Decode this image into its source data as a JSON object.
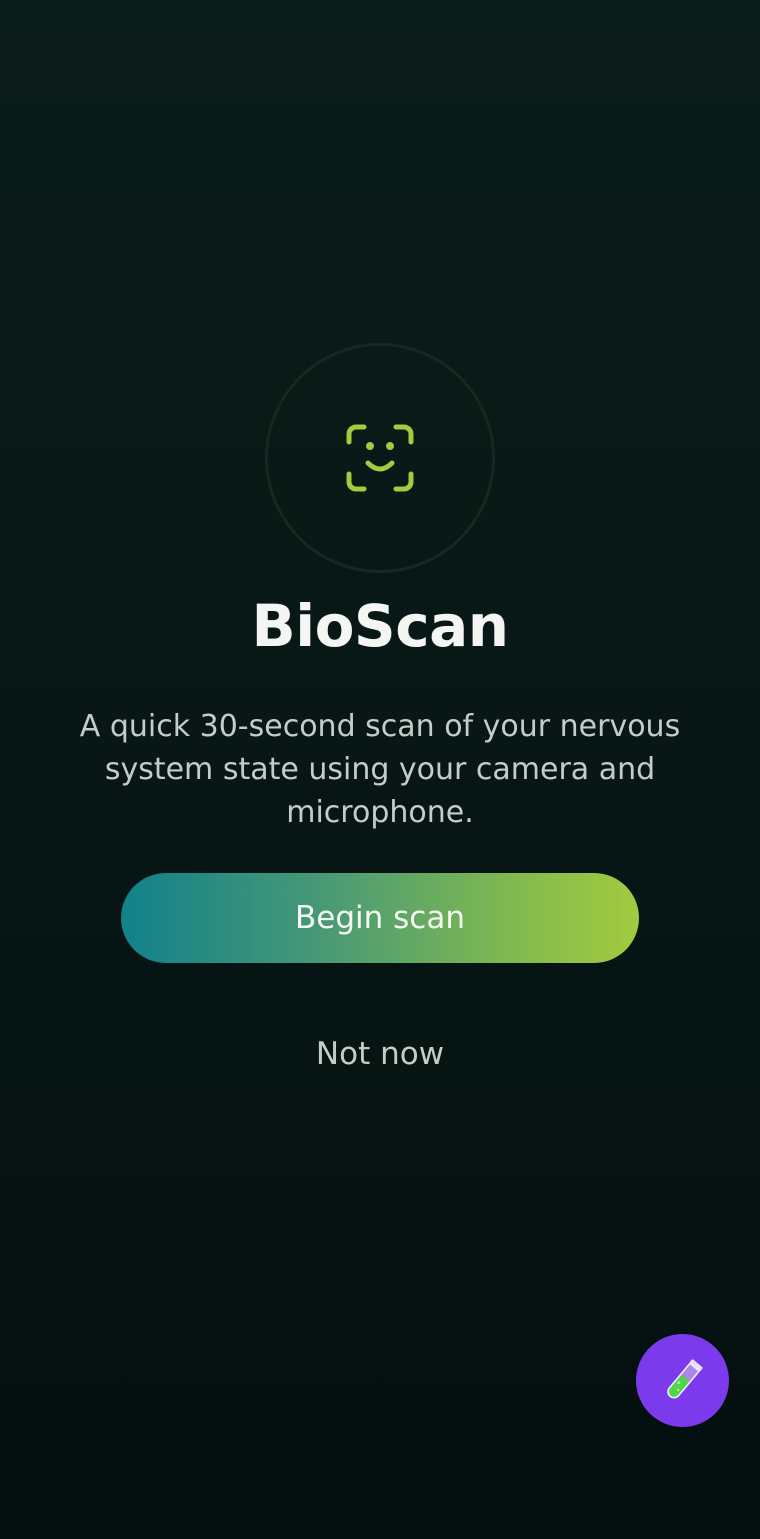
{
  "app": {
    "title": "BioScan",
    "description": "A quick 30-second scan of your nervous system state using your camera and microphone."
  },
  "actions": {
    "begin_label": "Begin scan",
    "dismiss_label": "Not now"
  },
  "icons": {
    "hero": "face-scan-icon",
    "fab": "test-tube-icon"
  },
  "colors": {
    "accent": "#a2cb3e",
    "gradient_start": "#11818b",
    "gradient_end": "#a2cb3e",
    "fab_background": "#7c3aed"
  }
}
